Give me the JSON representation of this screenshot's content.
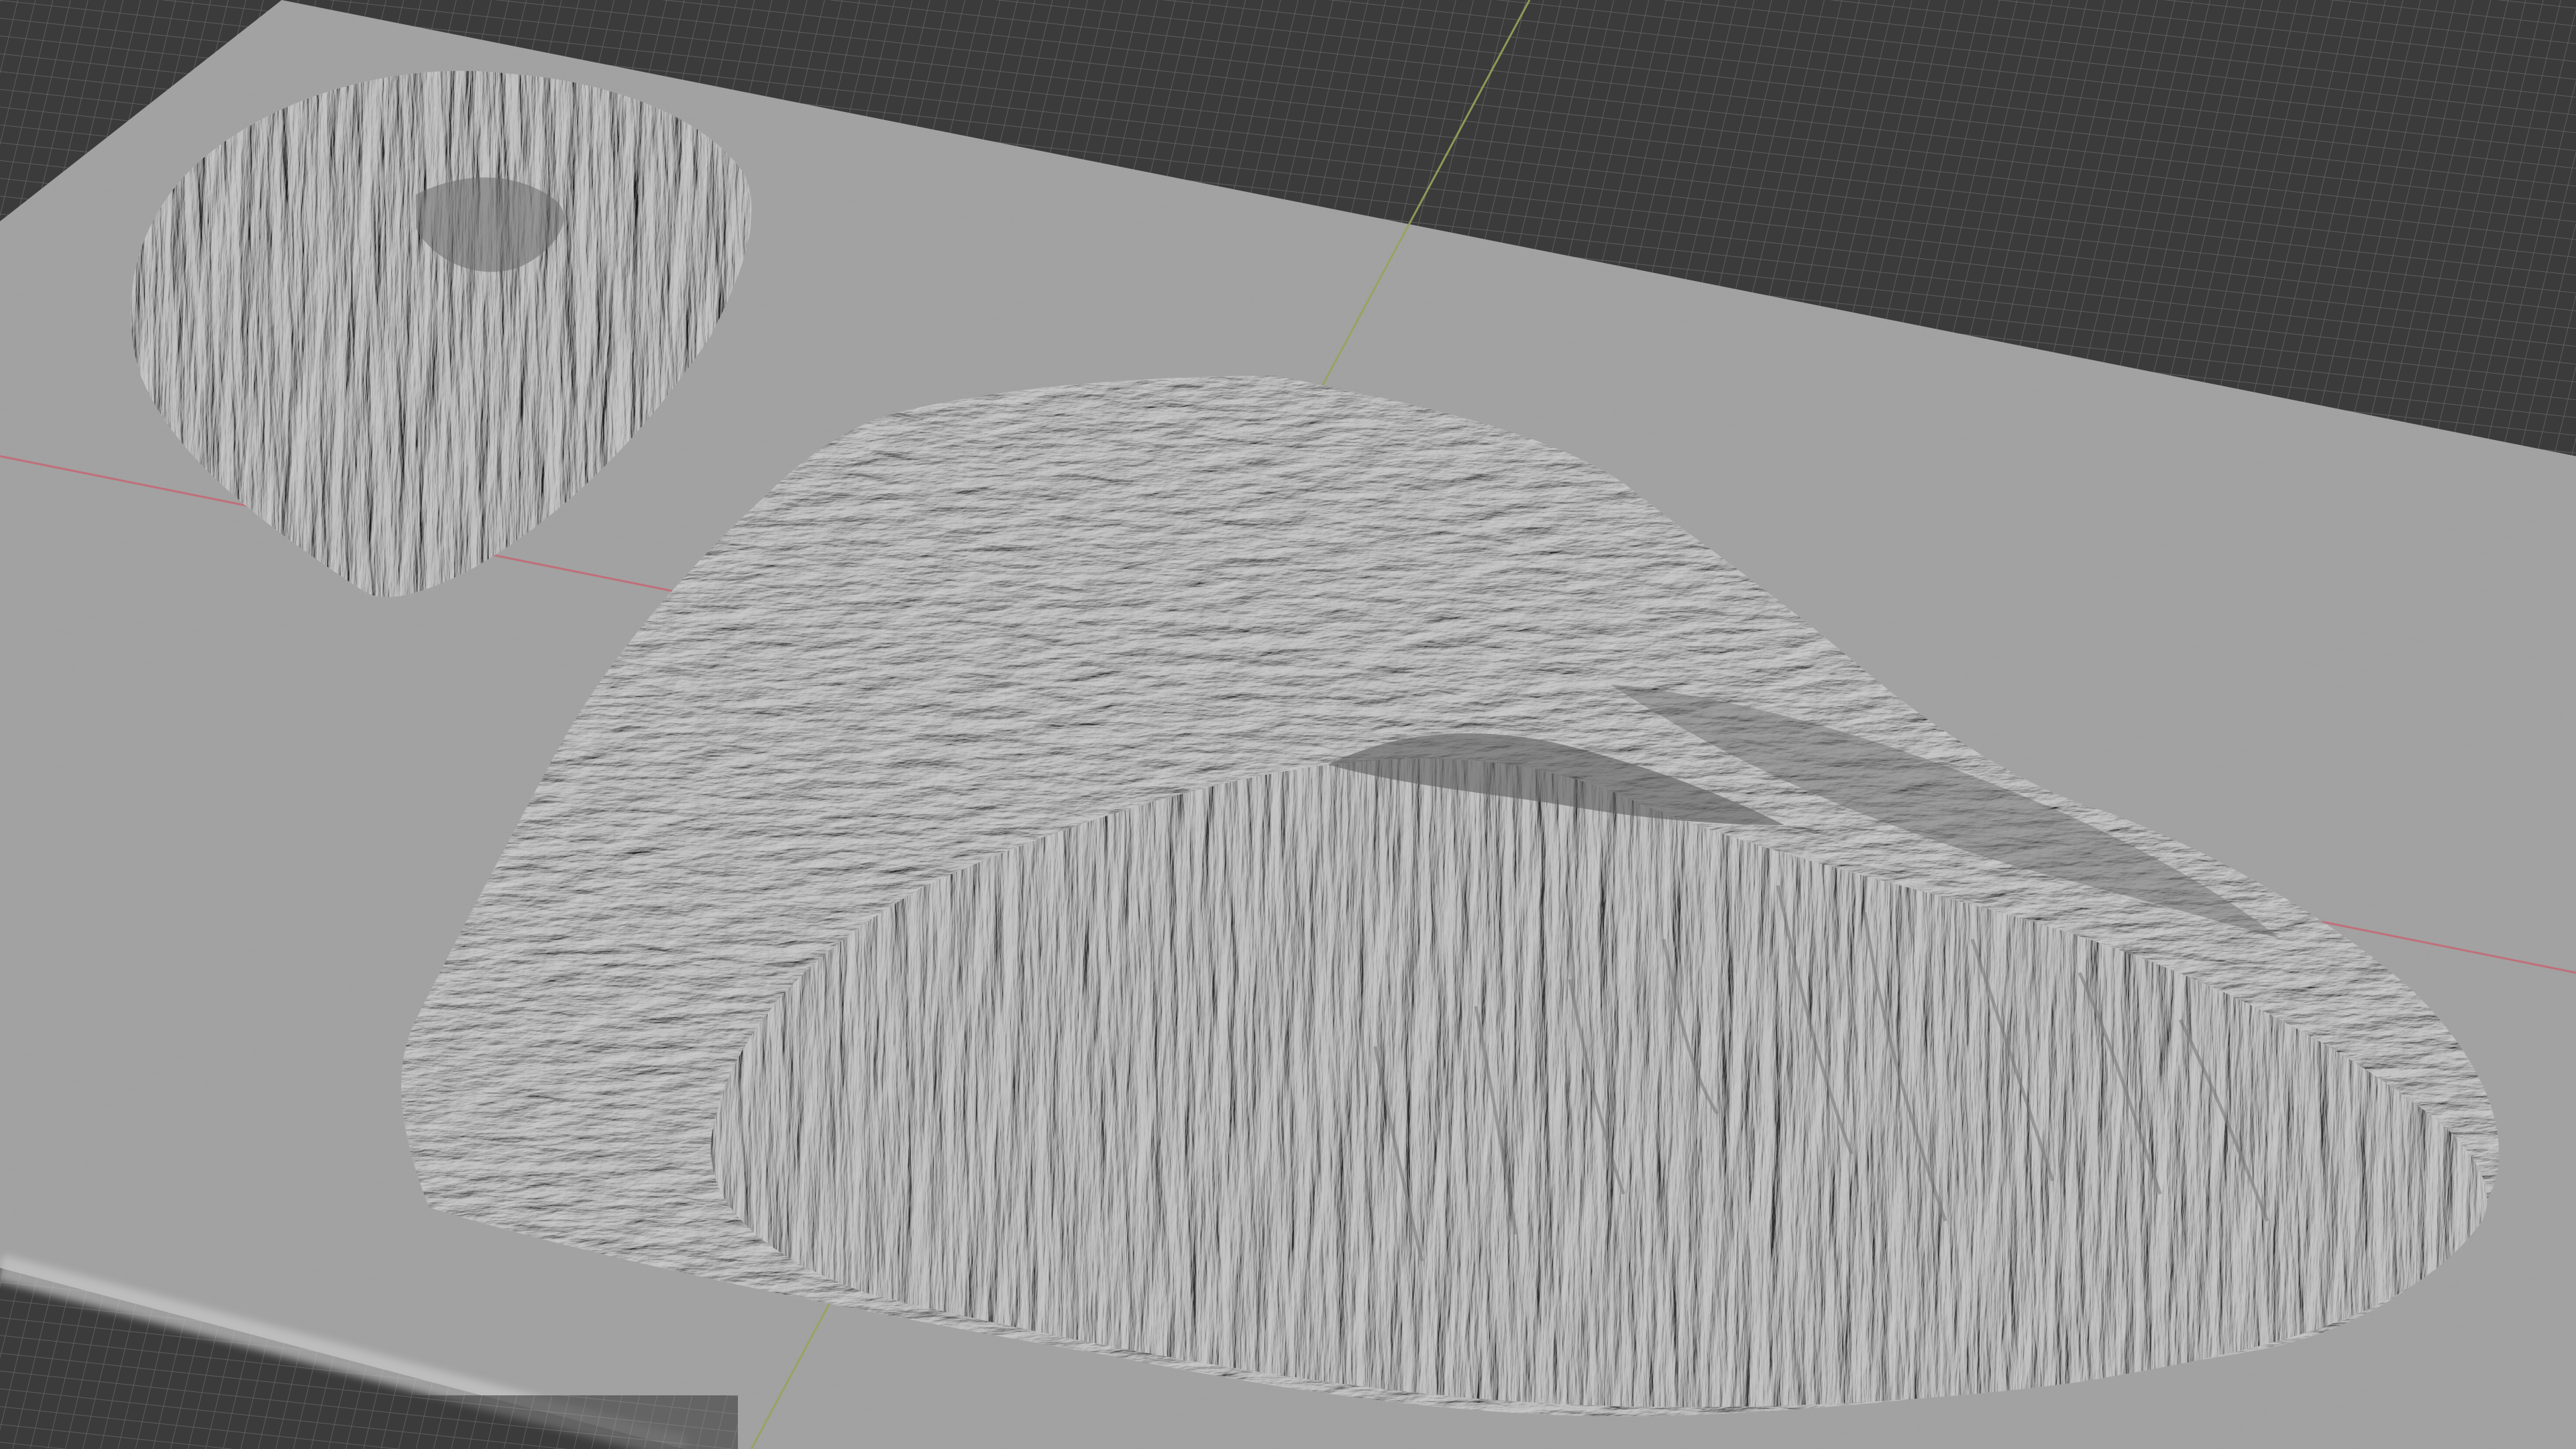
{
  "viewport": {
    "background_color": "#3a3a3a",
    "grid_line_color": "#5c5c5c",
    "terrain_plane_color": "#a3a3a3",
    "terrain_highlight_color": "#bdbdbd",
    "terrain_shadow_color": "#6e6e6e",
    "x_axis_color": "#c46a76",
    "y_axis_color": "#9aa25a"
  },
  "scene": {
    "objects": [
      {
        "kind": "terrain-plane"
      },
      {
        "kind": "island",
        "label": "small-island"
      },
      {
        "kind": "island",
        "label": "large-island"
      }
    ]
  }
}
